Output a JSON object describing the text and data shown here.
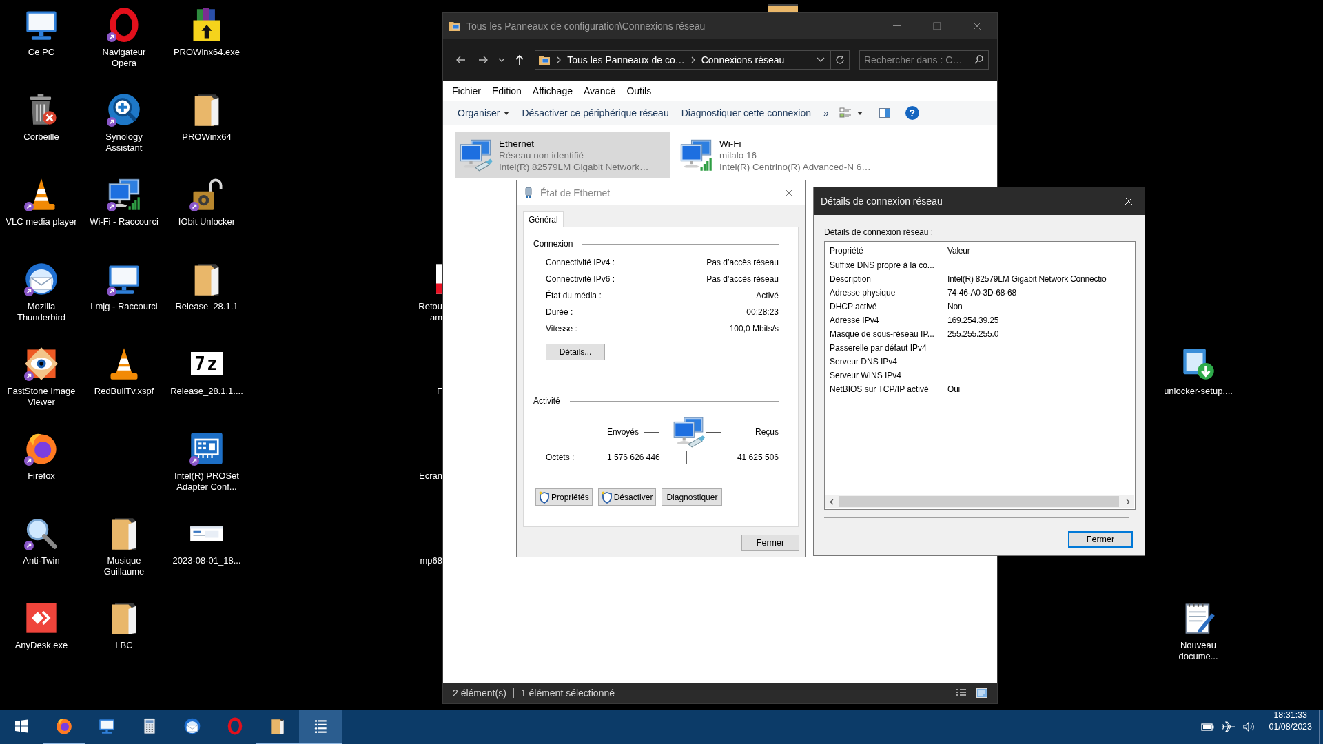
{
  "desktop": {
    "icons_left": [
      [
        {
          "label": [
            "Ce PC"
          ],
          "kind": "pc",
          "shortcut": false
        },
        {
          "label": [
            "Corbeille"
          ],
          "kind": "trash",
          "shortcut": false
        },
        {
          "label": [
            "VLC media player"
          ],
          "kind": "cone",
          "shortcut": true
        },
        {
          "label": [
            "Mozilla",
            "Thunderbird"
          ],
          "kind": "mail",
          "shortcut": true
        },
        {
          "label": [
            "FastStone Image",
            "Viewer"
          ],
          "kind": "eye",
          "shortcut": true
        },
        {
          "label": [
            "Firefox"
          ],
          "kind": "fox",
          "shortcut": true
        },
        {
          "label": [
            "Anti-Twin"
          ],
          "kind": "magnifier",
          "shortcut": true
        },
        {
          "label": [
            "AnyDesk.exe"
          ],
          "kind": "anydesk",
          "shortcut": false
        }
      ],
      [
        {
          "label": [
            "Navigateur",
            "Opera"
          ],
          "kind": "ring",
          "shortcut": true
        },
        {
          "label": [
            "Synology",
            "Assistant"
          ],
          "kind": "synology",
          "shortcut": true
        },
        {
          "label": [
            "Wi-Fi - Raccourci"
          ],
          "kind": "network",
          "shortcut": true
        },
        {
          "label": [
            "Lmjg - Raccourci"
          ],
          "kind": "pc",
          "shortcut": true
        },
        {
          "label": [
            "RedBullTv.xspf"
          ],
          "kind": "cone",
          "shortcut": false
        },
        {
          "kind": "blank"
        },
        {
          "label": [
            "Musique",
            "Guillaume"
          ],
          "kind": "folder",
          "shortcut": false
        },
        {
          "label": [
            "LBC"
          ],
          "kind": "folder",
          "shortcut": false
        }
      ],
      [
        {
          "label": [
            "PROWinx64.exe"
          ],
          "kind": "archive",
          "shortcut": false
        },
        {
          "label": [
            "PROWinx64"
          ],
          "kind": "folder",
          "shortcut": false
        },
        {
          "label": [
            "IObit Unlocker"
          ],
          "kind": "padlock",
          "shortcut": true
        },
        {
          "label": [
            "Release_28.1.1"
          ],
          "kind": "folder",
          "shortcut": false
        },
        {
          "label": [
            "Release_28.1.1...."
          ],
          "kind": "sevenzip",
          "glyph": "7z",
          "shortcut": false
        },
        {
          "label": [
            "Intel(R) PROSet",
            "Adapter Conf..."
          ],
          "kind": "card",
          "shortcut": true
        },
        {
          "label": [
            "2023-08-01_18..."
          ],
          "kind": "screenshot",
          "shortcut": false
        }
      ]
    ],
    "icons_hidden": [
      {
        "label": [
          "Retou",
          "am"
        ],
        "kind": "document"
      },
      {
        "label": [
          "F"
        ],
        "kind": "folder"
      },
      {
        "label": [
          "Ecran"
        ],
        "kind": "folder"
      },
      {
        "label": [
          "mp68"
        ],
        "kind": "folder"
      }
    ],
    "icons_right": [
      {
        "kind": "blank"
      },
      {
        "kind": "blank"
      },
      {
        "kind": "blank"
      },
      {
        "kind": "blank"
      },
      {
        "label": [
          "unlocker-setup...."
        ],
        "kind": "installer",
        "shortcut": false
      },
      {
        "kind": "blank"
      },
      {
        "kind": "blank"
      },
      {
        "label": [
          "Nouveau",
          "docume..."
        ],
        "kind": "notepad",
        "shortcut": false
      }
    ]
  },
  "explorer": {
    "title": "Tous les Panneaux de configuration\\Connexions réseau",
    "breadcrumb": [
      "Tous les Panneaux de co…",
      "Connexions réseau"
    ],
    "search": {
      "placeholder": "Rechercher dans : C…"
    },
    "menu": [
      "Fichier",
      "Edition",
      "Affichage",
      "Avancé",
      "Outils"
    ],
    "toolbar": [
      {
        "label": "Organiser",
        "dropdown": true
      },
      {
        "label": "Désactiver ce périphérique réseau",
        "dropdown": false
      },
      {
        "label": "Diagnostiquer cette connexion",
        "dropdown": false
      }
    ],
    "more": "»",
    "help": "?",
    "connections": [
      {
        "name": "Ethernet",
        "status": "Réseau non identifié",
        "adapter": "Intel(R) 82579LM Gigabit Network…",
        "kind": "ethernet",
        "selected": true
      },
      {
        "name": "Wi-Fi",
        "status": "milalo 16",
        "adapter": "Intel(R) Centrino(R) Advanced-N 6…",
        "kind": "wifi",
        "selected": false
      }
    ],
    "status_bar": [
      "2 élément(s)",
      "1 élément sélectionné"
    ]
  },
  "ethernet_status": {
    "title": "État de Ethernet",
    "tabs": [
      {
        "label": "Général",
        "selected": true
      }
    ],
    "connection": {
      "heading": "Connexion",
      "rows": [
        {
          "label": "Connectivité IPv4 :",
          "value": "Pas d’accès réseau"
        },
        {
          "label": "Connectivité IPv6 :",
          "value": "Pas d’accès réseau"
        },
        {
          "label": "État du média :",
          "value": "Activé"
        },
        {
          "label": "Durée :",
          "value": "00:28:23"
        },
        {
          "label": "Vitesse :",
          "value": "100,0 Mbits/s"
        }
      ],
      "details_button": "Détails..."
    },
    "activity": {
      "heading": "Activité",
      "sent_label": "Envoyés",
      "received_label": "Reçus",
      "bytes_label": "Octets :",
      "sent": "1 576 626 446",
      "received": "41 625 506"
    },
    "buttons": [
      {
        "label": "Propriétés",
        "shield": true
      },
      {
        "label": "Désactiver",
        "shield": true
      },
      {
        "label": "Diagnostiquer",
        "shield": false
      }
    ],
    "close_button": "Fermer"
  },
  "connection_details": {
    "title": "Détails de connexion réseau",
    "caption": "Détails de connexion réseau :",
    "columns": [
      "Propriété",
      "Valeur"
    ],
    "rows": [
      {
        "property": "Suffixe DNS propre à la co..."
      },
      {
        "property": "Description",
        "value": "Intel(R) 82579LM Gigabit Network Connectio"
      },
      {
        "property": "Adresse physique",
        "value": "74-46-A0-3D-68-68"
      },
      {
        "property": "DHCP activé",
        "value": "Non"
      },
      {
        "property": "Adresse IPv4",
        "value": "169.254.39.25"
      },
      {
        "property": "Masque de sous-réseau IP...",
        "value": "255.255.255.0"
      },
      {
        "property": "Passerelle par défaut IPv4"
      },
      {
        "property": "Serveur DNS IPv4"
      },
      {
        "property": "Serveur WINS IPv4"
      },
      {
        "property": "NetBIOS sur TCP/IP activé",
        "value": "Oui"
      }
    ],
    "close_button": {
      "label": "Fermer",
      "focused": true
    }
  },
  "taskbar": {
    "apps": [
      {
        "kind": "fox",
        "running": true,
        "active": false
      },
      {
        "kind": "pc",
        "running": false,
        "active": false
      },
      {
        "kind": "calculator",
        "running": false,
        "active": false
      },
      {
        "kind": "mail",
        "running": false,
        "active": false
      },
      {
        "kind": "ring",
        "running": false,
        "active": false
      },
      {
        "kind": "folder",
        "running": true,
        "active": false
      },
      {
        "kind": "list",
        "running": true,
        "active": true
      }
    ],
    "clock": {
      "time": "18:31:33",
      "date": "01/08/2023"
    }
  }
}
